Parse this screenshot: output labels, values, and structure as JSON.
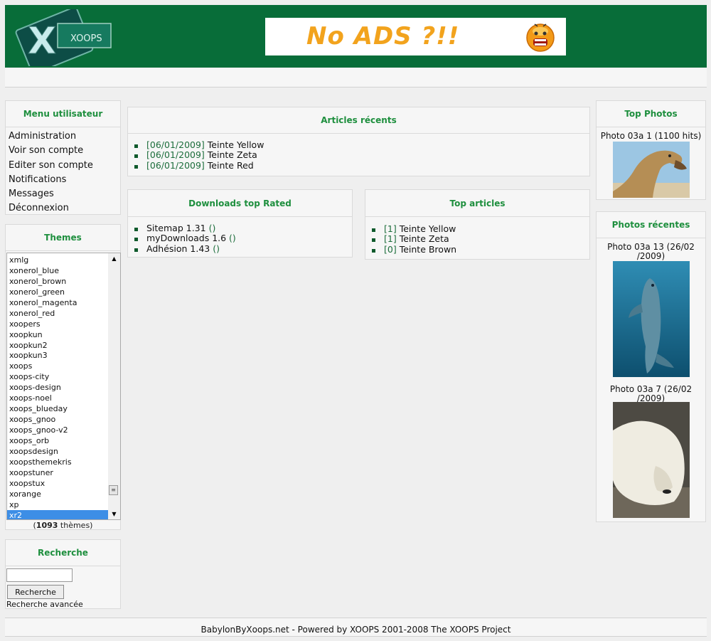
{
  "header": {
    "logo_text": "XOOPS",
    "banner_text": "No ADS ?!!"
  },
  "menu_block": {
    "title": "Menu utilisateur",
    "items": [
      "Administration",
      "Voir son compte",
      "Editer son compte",
      "Notifications",
      "Messages",
      "Déconnexion"
    ]
  },
  "themes_block": {
    "title": "Themes",
    "items": [
      "xmlg",
      "xonerol_blue",
      "xonerol_brown",
      "xonerol_green",
      "xonerol_magenta",
      "xonerol_red",
      "xoopers",
      "xoopkun",
      "xoopkun2",
      "xoopkun3",
      "xoops",
      "xoops-city",
      "xoops-design",
      "xoops-noel",
      "xoops_blueday",
      "xoops_gnoo",
      "xoops_gnoo-v2",
      "xoops_orb",
      "xoopsdesign",
      "xoopsthemekris",
      "xoopstuner",
      "xoopstux",
      "xorange",
      "xp",
      "xr2"
    ],
    "selected": "xr2",
    "count_open": "(",
    "count": "1093",
    "count_suffix": " thèmes)"
  },
  "search_block": {
    "title": "Recherche",
    "input_value": "",
    "button_label": "Recherche",
    "advanced_label": "Recherche avancée"
  },
  "recent_articles": {
    "title": "Articles récents",
    "items": [
      {
        "date": "[06/01/2009]",
        "label": " Teinte Yellow"
      },
      {
        "date": "[06/01/2009]",
        "label": " Teinte Zeta"
      },
      {
        "date": "[06/01/2009]",
        "label": " Teinte Red"
      }
    ]
  },
  "downloads_top": {
    "title": "Downloads top Rated",
    "items": [
      {
        "label": "Sitemap 1.31 ",
        "paren": "()"
      },
      {
        "label": "myDownloads 1.6 ",
        "paren": "()"
      },
      {
        "label": "Adhésion 1.43 ",
        "paren": "()"
      }
    ]
  },
  "top_articles": {
    "title": "Top articles",
    "items": [
      {
        "count": "[1]",
        "label": " Teinte Yellow"
      },
      {
        "count": "[1]",
        "label": " Teinte Zeta"
      },
      {
        "count": "[0]",
        "label": " Teinte Brown"
      }
    ]
  },
  "top_photos": {
    "title": "Top Photos",
    "items": [
      {
        "caption": "Photo 03a 1 (1100 hits)"
      }
    ]
  },
  "recent_photos": {
    "title": "Photos récentes",
    "items": [
      {
        "caption_line1": "Photo 03a 13 (26/02",
        "caption_line2": "/2009)"
      },
      {
        "caption_line1": "Photo 03a 7 (26/02",
        "caption_line2": "/2009)"
      }
    ]
  },
  "footer": {
    "text": "BabylonByXoops.net - Powered by XOOPS 2001-2008 The XOOPS Project"
  },
  "colors": {
    "header_bg": "#086d39",
    "block_title": "#1e8f3e",
    "link": "#1c6d3b",
    "selection": "#3d8ee6"
  }
}
